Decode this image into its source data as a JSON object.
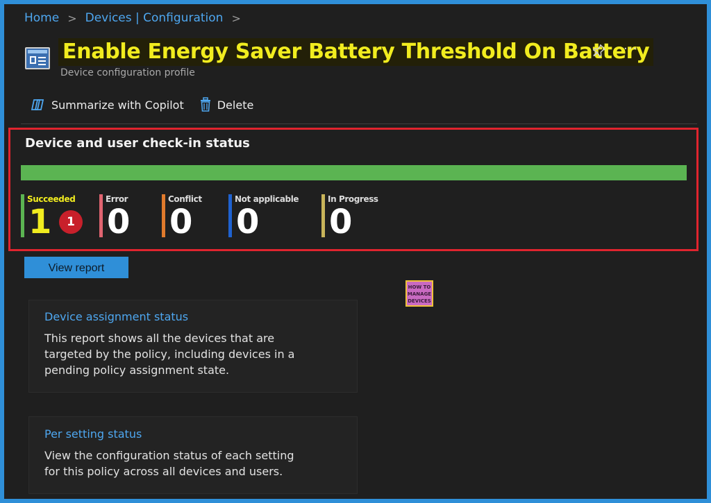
{
  "breadcrumb": {
    "items": [
      "Home",
      "Devices | Configuration"
    ],
    "separator": ">"
  },
  "header": {
    "title": "Enable Energy Saver Battery Threshold On Battery",
    "subtitle": "Device configuration profile",
    "more_label": "···"
  },
  "toolbar": {
    "copilot_label": "Summarize with Copilot",
    "delete_label": "Delete"
  },
  "checkin_status": {
    "heading": "Device and user check-in status",
    "progress_succeeded_fraction": 1.0,
    "counters": [
      {
        "label": "Succeeded",
        "value": "1",
        "color": "#5bb452",
        "label_color": "#f1ec1f",
        "value_color": "#f1ec1f"
      },
      {
        "label": "Error",
        "value": "0",
        "color": "#e06470"
      },
      {
        "label": "Conflict",
        "value": "0",
        "color": "#e07a2c"
      },
      {
        "label": "Not applicable",
        "value": "0",
        "color": "#1f62d0"
      },
      {
        "label": "In Progress",
        "value": "0",
        "color": "#c8b45a"
      }
    ],
    "callout_badge": "1"
  },
  "view_report_label": "View report",
  "watermark": {
    "line1": "HOW TO",
    "line2": "MANAGE",
    "line3": "DEVICES"
  },
  "cards": [
    {
      "title": "Device assignment status",
      "text": "This report shows all the devices that are targeted by the policy, including devices in a pending policy assignment state."
    },
    {
      "title": "Per setting status",
      "text": "View the configuration status of each setting for this policy across all devices and users."
    }
  ],
  "colors": {
    "accent": "#2f8fd8",
    "title_highlight": "#f1ec1f",
    "callout_border": "#e0242e",
    "success": "#5bb452"
  }
}
